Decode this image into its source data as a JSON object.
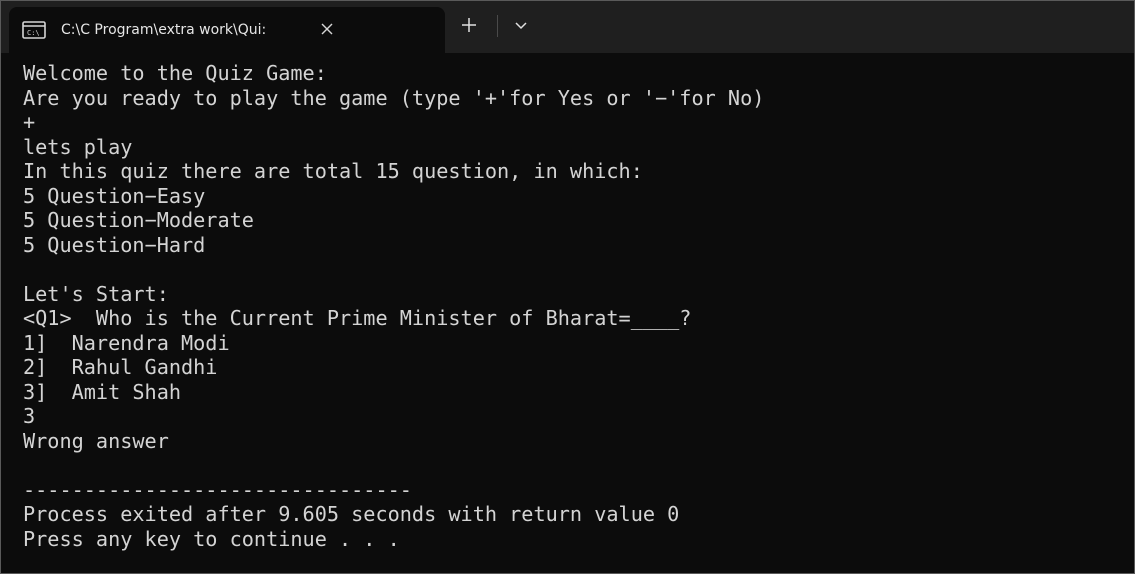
{
  "tab": {
    "title": "C:\\C Program\\extra work\\Qui:",
    "icon": "console-icon"
  },
  "tabbar": {
    "new_tab_icon": "plus-icon",
    "dropdown_icon": "chevron-down-icon",
    "close_icon": "close-icon"
  },
  "console": {
    "lines": [
      "Welcome to the Quiz Game:",
      "Are you ready to play the game (type '+'for Yes or '−'for No)",
      "+",
      "lets play",
      "In this quiz there are total 15 question, in which:",
      "5 Question−Easy",
      "5 Question−Moderate",
      "5 Question−Hard",
      "",
      "Let's Start:",
      "<Q1>  Who is the Current Prime Minister of Bharat=____?",
      "1]  Narendra Modi",
      "2]  Rahul Gandhi",
      "3]  Amit Shah",
      "3",
      "Wrong answer",
      "",
      "--------------------------------",
      "Process exited after 9.605 seconds with return value 0",
      "Press any key to continue . . ."
    ]
  },
  "colors": {
    "background": "#0c0c0c",
    "tabbar": "#1f1f1f",
    "text": "#d4d4d4"
  }
}
